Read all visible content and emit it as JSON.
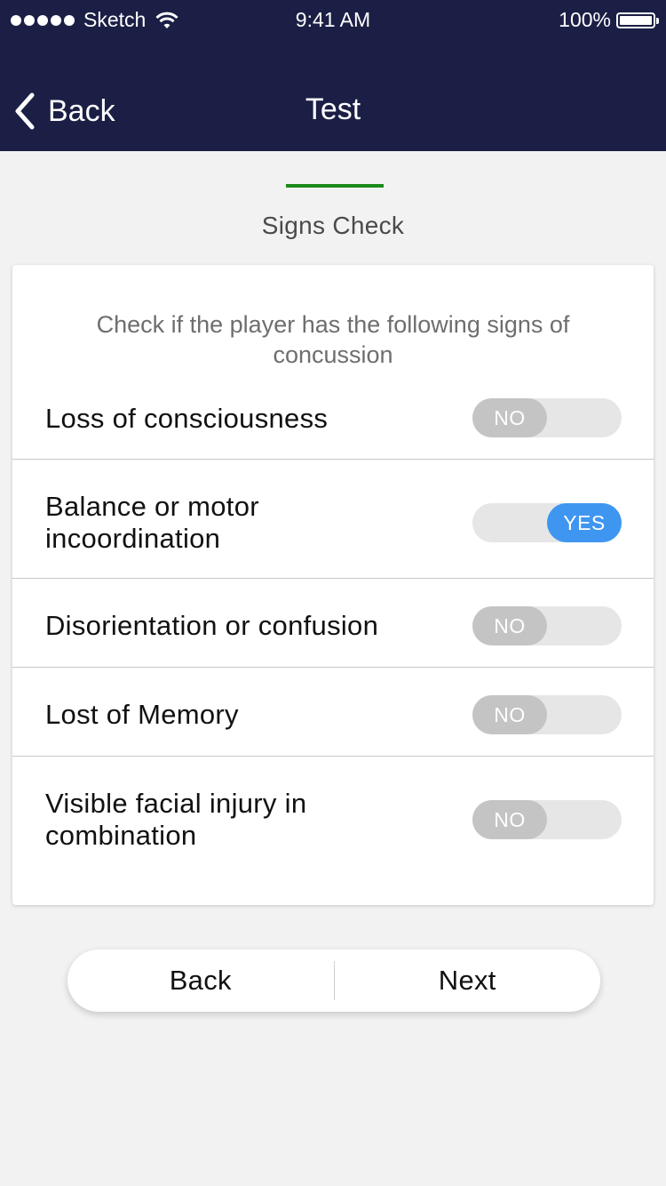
{
  "status_bar": {
    "carrier": "Sketch",
    "time": "9:41 AM",
    "battery": "100%",
    "icons": [
      "signal-dots-icon",
      "wifi-icon",
      "battery-icon"
    ]
  },
  "nav": {
    "back_label": "Back",
    "title": "Test",
    "background_color": "#1b1f45"
  },
  "step": {
    "title": "Signs Check",
    "indicator_color": "#1b8a1b"
  },
  "card": {
    "instruction": "Check if the player has the following signs of concussion",
    "signs": [
      {
        "label": "Loss of consciousness",
        "value": "NO"
      },
      {
        "label": "Balance or motor incoordination",
        "value": "YES"
      },
      {
        "label": "Disorientation or confusion",
        "value": "NO"
      },
      {
        "label": "Lost of Memory",
        "value": "NO"
      },
      {
        "label": "Visible facial injury in combination",
        "value": "NO"
      }
    ]
  },
  "buttons": {
    "back_label": "Back",
    "next_label": "Next"
  },
  "colors": {
    "toggle_yes": "#3e96f0",
    "toggle_no": "#c4c4c4"
  }
}
